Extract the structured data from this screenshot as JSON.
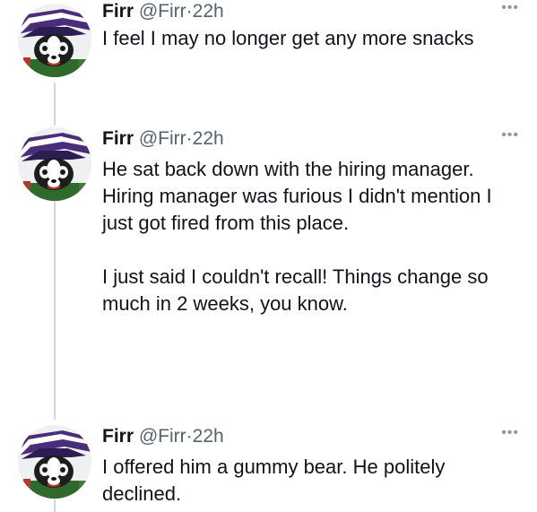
{
  "icons": {
    "more": "more-horizontal-icon"
  },
  "tweets": [
    {
      "name": "Firr",
      "handle": "@Firr",
      "dot": "·",
      "time": "22h",
      "paragraphs": [
        "I feel I may no longer get any more snacks"
      ]
    },
    {
      "name": "Firr",
      "handle": "@Firr",
      "dot": "·",
      "time": "22h",
      "paragraphs": [
        "He sat back down with the hiring manager.  Hiring manager was furious I didn't mention I just got fired from this place.",
        "I just said I couldn't recall! Things change so much in 2 weeks, you know."
      ]
    },
    {
      "name": "Firr",
      "handle": "@Firr",
      "dot": "·",
      "time": "22h",
      "paragraphs": [
        "I offered him a gummy bear.  He politely declined."
      ]
    }
  ]
}
